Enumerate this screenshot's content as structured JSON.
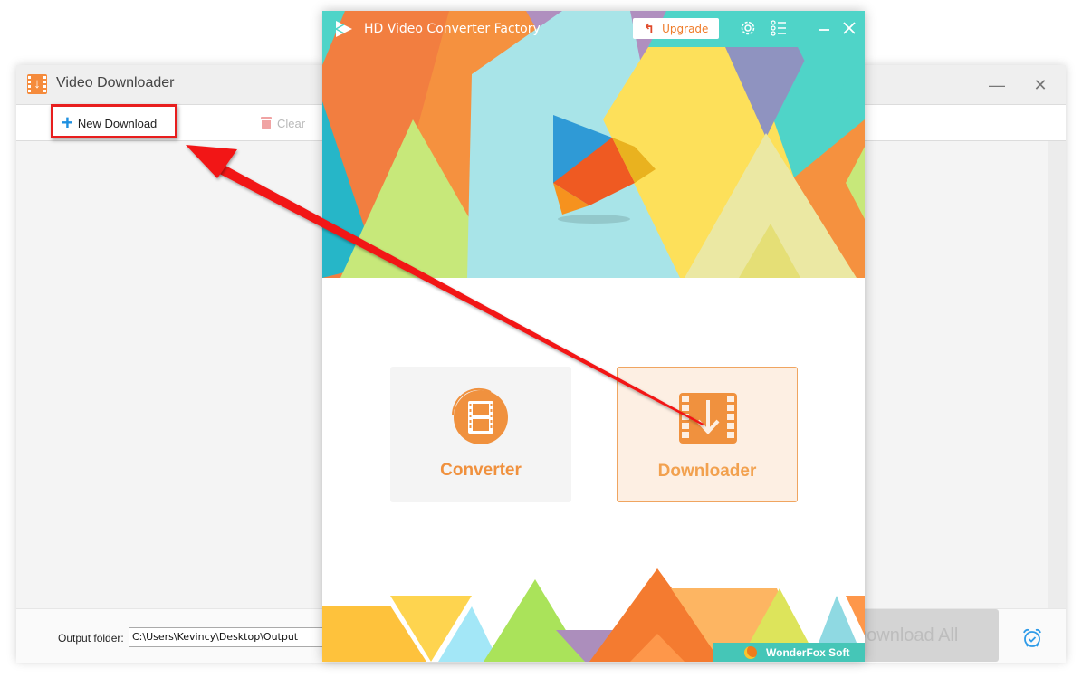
{
  "video_downloader": {
    "title": "Video Downloader",
    "window_controls": {
      "minimize": "—",
      "close": "✕"
    },
    "toolbar": {
      "new_download_label": "New Download",
      "clear_label": "Clear"
    },
    "footer": {
      "output_folder_label": "Output folder:",
      "output_folder_value": "C:\\Users\\Kevincy\\Desktop\\Output",
      "download_all_label": "Download All"
    },
    "icons": {
      "app": "video-download-icon",
      "new_download": "plus-icon",
      "clear": "trash-icon",
      "schedule": "alarm-clock-icon"
    }
  },
  "hd_converter": {
    "title": "HD Video Converter Factory",
    "upgrade_label": "Upgrade",
    "tiles": [
      {
        "label": "Converter",
        "icon": "film-convert-icon",
        "selected": false
      },
      {
        "label": "Downloader",
        "icon": "film-download-icon",
        "selected": true
      }
    ],
    "brand_label": "WonderFox Soft",
    "colors": {
      "accent_orange": "#f0913e",
      "teal": "#4fd4c8",
      "selected_tile_bg": "#fdefe3",
      "selected_tile_border": "#f0a560"
    }
  },
  "annotation": {
    "highlight_color": "#e81e1e",
    "arrow": "from Downloader tile to New Download button"
  }
}
